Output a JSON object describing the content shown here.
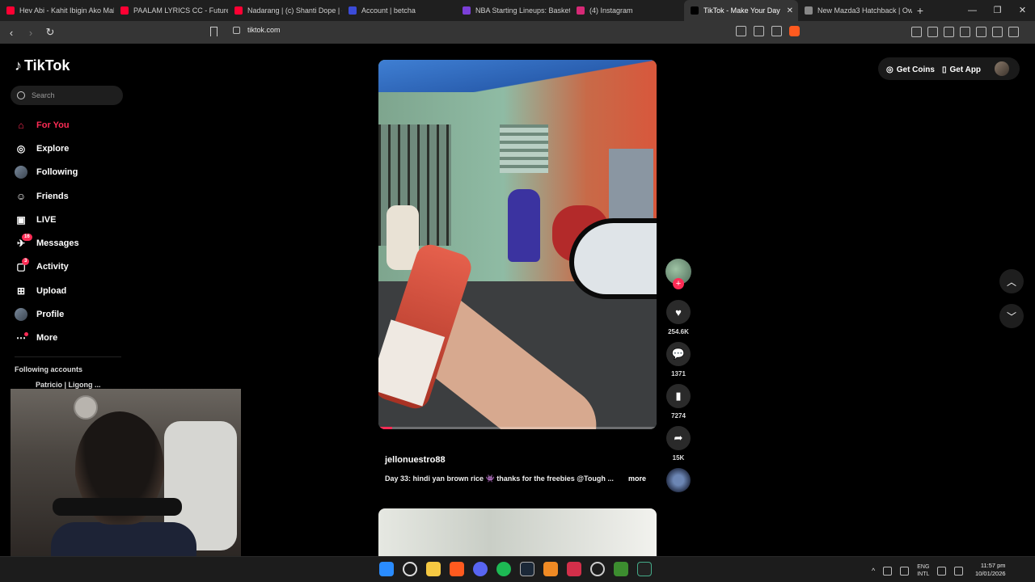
{
  "browser": {
    "tabs": [
      {
        "label": "Hev Abi - Kahit Ibigin Ako Mal",
        "color": "#ff0033"
      },
      {
        "label": "PAALAM LYRICS CC - Future Th",
        "color": "#ff0033"
      },
      {
        "label": "Nadarang | (c) Shanti Dope | #",
        "color": "#ff0033"
      },
      {
        "label": "Account | betcha",
        "color": "#3b4bd8"
      },
      {
        "label": "NBA Starting Lineups: Basketb",
        "color": "#7b3fd8"
      },
      {
        "label": "(4) Instagram",
        "color": "#d62976"
      },
      {
        "label": "TikTok - Make Your Day",
        "color": "#000000",
        "active": true
      },
      {
        "label": "New Mazda3 Hatchback | Own",
        "color": "#888888"
      }
    ],
    "url": "tiktok.com"
  },
  "sidebar": {
    "logo": "TikTok",
    "search_placeholder": "Search",
    "items": [
      {
        "label": "For You",
        "icon": "home-icon",
        "glyph": "⌂",
        "active": true
      },
      {
        "label": "Explore",
        "icon": "compass-icon",
        "glyph": "◎"
      },
      {
        "label": "Following",
        "icon": "avatar-icon",
        "glyph": ""
      },
      {
        "label": "Friends",
        "icon": "friends-icon",
        "glyph": "☺"
      },
      {
        "label": "LIVE",
        "icon": "live-icon",
        "glyph": "▣"
      },
      {
        "label": "Messages",
        "icon": "message-icon",
        "glyph": "✈",
        "badge": "16"
      },
      {
        "label": "Activity",
        "icon": "activity-icon",
        "glyph": "▢",
        "badge": "3"
      },
      {
        "label": "Upload",
        "icon": "upload-icon",
        "glyph": "⊞"
      },
      {
        "label": "Profile",
        "icon": "profile-icon",
        "glyph": ""
      },
      {
        "label": "More",
        "icon": "more-icon",
        "glyph": "⋯",
        "dot": true
      }
    ],
    "following_title": "Following accounts",
    "following_accounts": [
      "Patricio | Ligong ..."
    ]
  },
  "header": {
    "get_coins": "Get Coins",
    "get_app": "Get App"
  },
  "video": {
    "author": "jellonuestro88",
    "caption": "Day 33: hindi yan brown rice 👾 thanks for the freebies @Tough ...",
    "more": "more",
    "progress": 0.05,
    "likes": "254.6K",
    "comments": "1371",
    "saves": "7274",
    "shares": "15K"
  },
  "taskbar": {
    "lang_top": "ENG",
    "lang_bottom": "INTL",
    "time": "11:57 pm",
    "date": "10/01/2026"
  }
}
